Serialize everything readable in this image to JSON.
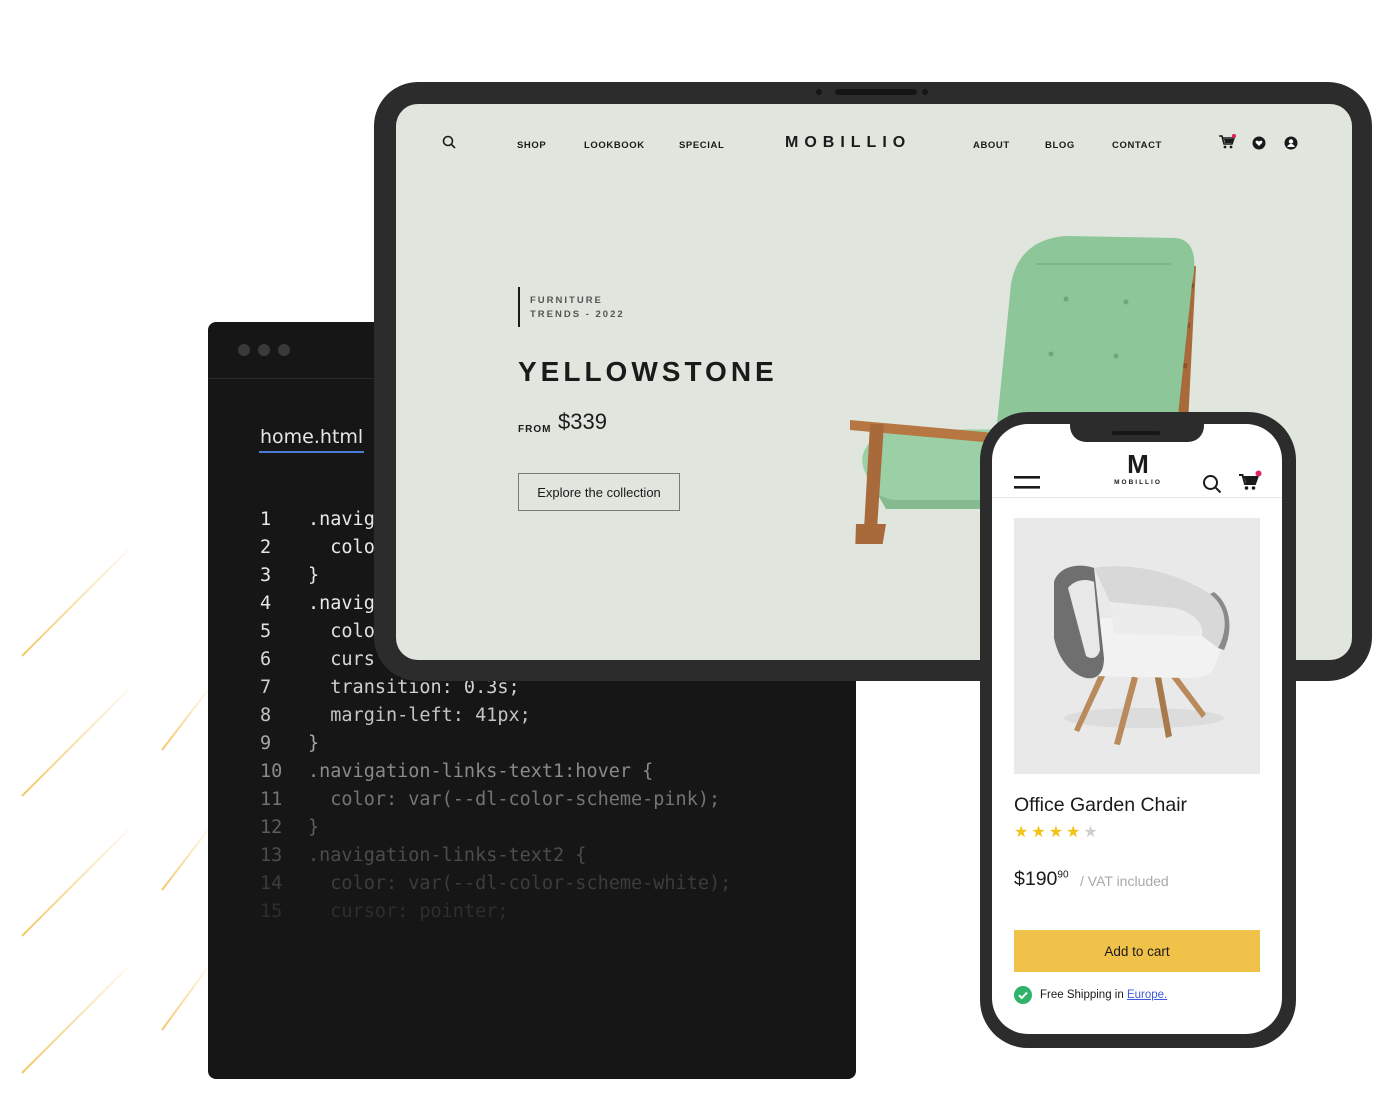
{
  "editor": {
    "tab_label": "home.html",
    "lines": [
      {
        "num": "1",
        "text": ".navig",
        "color": "#e8e8e8"
      },
      {
        "num": "2",
        "text": "  colo",
        "color": "#e8e8e8"
      },
      {
        "num": "3",
        "text": "}",
        "color": "#e8e8e8"
      },
      {
        "num": "4",
        "text": ".navig",
        "color": "#e8e8e8"
      },
      {
        "num": "5",
        "text": "  colo",
        "color": "#e0e0e0"
      },
      {
        "num": "6",
        "text": "  curs",
        "color": "#d8d8d8"
      },
      {
        "num": "7",
        "text": "  transition: 0.3s;",
        "color": "#d0d0d0"
      },
      {
        "num": "8",
        "text": "  margin-left: 41px;",
        "color": "#c4c4c4"
      },
      {
        "num": "9",
        "text": "}",
        "color": "#a8a8a8"
      },
      {
        "num": "10",
        "text": ".navigation-links-text1:hover {",
        "color": "#8a8a8a"
      },
      {
        "num": "11",
        "text": "  color: var(--dl-color-scheme-pink);",
        "color": "#747474"
      },
      {
        "num": "12",
        "text": "}",
        "color": "#5e5e5e"
      },
      {
        "num": "13",
        "text": ".navigation-links-text2 {",
        "color": "#4c4c4c"
      },
      {
        "num": "14",
        "text": "  color: var(--dl-color-scheme-white);",
        "color": "#3c3c3c"
      },
      {
        "num": "15",
        "text": "  cursor: pointer;",
        "color": "#2e2e2e"
      }
    ]
  },
  "tablet": {
    "nav_left": [
      "SHOP",
      "LOOKBOOK",
      "SPECIAL"
    ],
    "brand": "MOBILLIO",
    "nav_right": [
      "ABOUT",
      "BLOG",
      "CONTACT"
    ],
    "hero": {
      "eyebrow_line1": "FURNITURE",
      "eyebrow_line2": "TRENDS - 2022",
      "title": "YELLOWSTONE",
      "from_label": "FROM",
      "price": "$339",
      "cta": "Explore the collection"
    }
  },
  "phone": {
    "logo_letter": "M",
    "logo_text": "MOBILLIO",
    "product": {
      "title": "Office Garden Chair",
      "rating": 4,
      "rating_max": 5,
      "price_main": "$190",
      "price_cents": "90",
      "vat_text": "/ VAT included",
      "add_to_cart": "Add to cart",
      "shipping_text": "Free Shipping in",
      "shipping_link": "Europe."
    }
  },
  "colors": {
    "accent_pink": "#e0236a",
    "cart_button": "#f0c24a",
    "check_green": "#2fb36b",
    "star_gold": "#f2c318",
    "star_empty": "#cfcfcf",
    "link_blue": "#3d5bd8",
    "tablet_bg": "#e0e6dd"
  }
}
